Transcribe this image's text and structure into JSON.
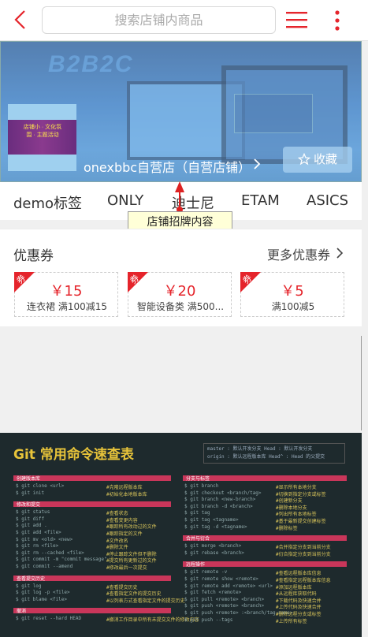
{
  "header": {
    "search_placeholder": "搜索店铺内商品"
  },
  "banner": {
    "bg_title": "B2B2C",
    "logo_text": "店铺小 · 文化氛围 · 主题活动",
    "shop_name": "onexbbc自营店（自营店铺）",
    "fav_label": "收藏"
  },
  "tabs": [
    "demo标签",
    "ONLY",
    "迪士尼",
    "ETAM",
    "ASICS"
  ],
  "tooltip": "店铺招牌内容",
  "coupons": {
    "title": "优惠券",
    "more": "更多优惠券",
    "corner_label": "券",
    "items": [
      {
        "amount": "￥15",
        "desc": "连衣裙 满100减15"
      },
      {
        "amount": "￥20",
        "desc": "智能设备类 满500..."
      },
      {
        "amount": "￥5",
        "desc": "满100减5"
      }
    ]
  },
  "git_sheet": {
    "title": "Git 常用命令速查表",
    "legend": [
      "master : 默认开发分支    Head : 默认开发分支",
      "origin : 默认远程版本库    Head^ : Head 的父提交"
    ],
    "sections_left": [
      "创建版本库",
      "修改和提交",
      "查看提交历史",
      "撤消"
    ],
    "sections_right": [
      "分支与标签",
      "合并与衍合",
      "远程操作"
    ],
    "left_lines": [
      "$ git clone <url>",
      "$ git init",
      "$ git status",
      "$ git diff",
      "$ git add .",
      "$ git add <file>",
      "$ git mv <old> <new>",
      "$ git rm <file>",
      "$ git rm --cached <file>",
      "$ git commit -m \"commit message\"",
      "$ git commit --amend",
      "$ git log",
      "$ git log -p <file>",
      "$ git blame <file>",
      "$ git reset --hard HEAD"
    ],
    "left_hints": [
      "#克隆远程版本库",
      "#初始化本地版本库",
      "#查看状态",
      "#查看变更内容",
      "#跟踪所有改动过的文件",
      "#跟踪指定的文件",
      "#文件改名",
      "#删除文件",
      "#停止跟踪文件但不删除",
      "#提交所有更新过的文件",
      "#修改最后一次提交",
      "#查看提交历史",
      "#查看指定文件的提交历史",
      "#以列表方式查看指定文件的提交历史",
      "#撤消工作目录中所有未提交文件的修改内容"
    ],
    "right_lines": [
      "$ git branch",
      "$ git checkout <branch/tag>",
      "$ git branch <new-branch>",
      "$ git branch -d <branch>",
      "$ git tag",
      "$ git tag <tagname>",
      "$ git tag -d <tagname>",
      "$ git merge <branch>",
      "$ git rebase <branch>",
      "$ git remote -v",
      "$ git remote show <remote>",
      "$ git remote add <remote> <url>",
      "$ git fetch <remote>",
      "$ git pull <remote> <branch>",
      "$ git push <remote> <branch>",
      "$ git push <remote> :<branch/tag-name>",
      "$ git push --tags"
    ],
    "right_hints": [
      "#显示所有本地分支",
      "#切换到指定分支或标签",
      "#创建新分支",
      "#删除本地分支",
      "#列出所有本地标签",
      "#基于最新提交创建标签",
      "#删除标签",
      "#合并指定分支到当前分支",
      "#衍合指定分支到当前分支",
      "#查看远程版本库信息",
      "#查看指定远程版本库信息",
      "#添加远程版本库",
      "#从远程库获取代码",
      "#下载代码及快速合并",
      "#上传代码及快速合并",
      "#删除远程分支或标签",
      "#上传所有标签"
    ]
  }
}
